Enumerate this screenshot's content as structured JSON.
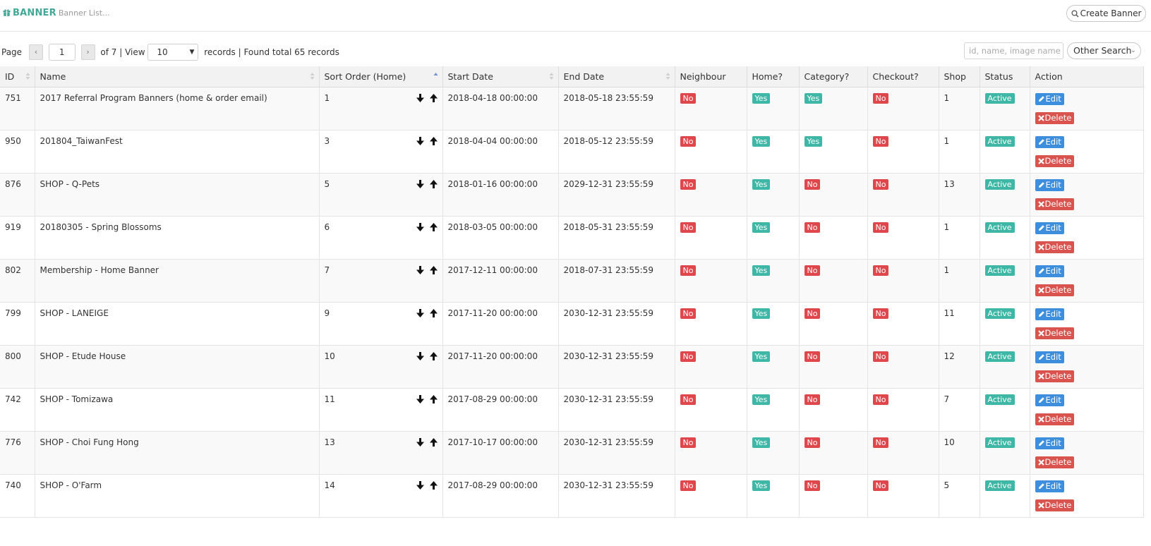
{
  "header": {
    "title": "BANNER",
    "subtitle": "Banner List...",
    "create_button": "Create Banner"
  },
  "pager": {
    "label_page": "Page",
    "prev_icon": "chevron-left-icon",
    "page_value": "1",
    "next_icon": "chevron-right-icon",
    "of_text": "of 7 | View",
    "per_page": "10",
    "records_text": "records | Found total 65 records"
  },
  "search": {
    "placeholder": "id, name, image name",
    "other_search": "Other Search"
  },
  "table": {
    "columns": [
      "ID",
      "Name",
      "Sort Order (Home)",
      "Start Date",
      "End Date",
      "Neighbour",
      "Home?",
      "Category?",
      "Checkout?",
      "Shop",
      "Status",
      "Action"
    ],
    "edit_label": "Edit",
    "delete_label": "Delete",
    "rows": [
      {
        "id": "751",
        "name": "2017 Referral Program Banners (home & order email)",
        "sort": "1",
        "start": "2018-04-18 00:00:00",
        "end": "2018-05-18 23:55:59",
        "neighbour": "No",
        "home": "Yes",
        "category": "Yes",
        "checkout": "No",
        "shop": "1",
        "status": "Active"
      },
      {
        "id": "950",
        "name": "201804_TaiwanFest",
        "sort": "3",
        "start": "2018-04-04 00:00:00",
        "end": "2018-05-12 23:55:59",
        "neighbour": "No",
        "home": "Yes",
        "category": "Yes",
        "checkout": "No",
        "shop": "1",
        "status": "Active"
      },
      {
        "id": "876",
        "name": "SHOP - Q-Pets",
        "sort": "5",
        "start": "2018-01-16 00:00:00",
        "end": "2029-12-31 23:55:59",
        "neighbour": "No",
        "home": "Yes",
        "category": "No",
        "checkout": "No",
        "shop": "13",
        "status": "Active"
      },
      {
        "id": "919",
        "name": "20180305 - Spring Blossoms",
        "sort": "6",
        "start": "2018-03-05 00:00:00",
        "end": "2018-05-31 23:55:59",
        "neighbour": "No",
        "home": "Yes",
        "category": "No",
        "checkout": "No",
        "shop": "1",
        "status": "Active"
      },
      {
        "id": "802",
        "name": "Membership - Home Banner",
        "sort": "7",
        "start": "2017-12-11 00:00:00",
        "end": "2018-07-31 23:55:59",
        "neighbour": "No",
        "home": "Yes",
        "category": "No",
        "checkout": "No",
        "shop": "1",
        "status": "Active"
      },
      {
        "id": "799",
        "name": "SHOP - LANEIGE",
        "sort": "9",
        "start": "2017-11-20 00:00:00",
        "end": "2030-12-31 23:55:59",
        "neighbour": "No",
        "home": "Yes",
        "category": "No",
        "checkout": "No",
        "shop": "11",
        "status": "Active"
      },
      {
        "id": "800",
        "name": "SHOP - Etude House",
        "sort": "10",
        "start": "2017-11-20 00:00:00",
        "end": "2030-12-31 23:55:59",
        "neighbour": "No",
        "home": "Yes",
        "category": "No",
        "checkout": "No",
        "shop": "12",
        "status": "Active"
      },
      {
        "id": "742",
        "name": "SHOP - Tomizawa",
        "sort": "11",
        "start": "2017-08-29 00:00:00",
        "end": "2030-12-31 23:55:59",
        "neighbour": "No",
        "home": "Yes",
        "category": "No",
        "checkout": "No",
        "shop": "7",
        "status": "Active"
      },
      {
        "id": "776",
        "name": "SHOP - Choi Fung Hong",
        "sort": "13",
        "start": "2017-10-17 00:00:00",
        "end": "2030-12-31 23:55:59",
        "neighbour": "No",
        "home": "Yes",
        "category": "No",
        "checkout": "No",
        "shop": "10",
        "status": "Active"
      },
      {
        "id": "740",
        "name": "SHOP - O'Farm",
        "sort": "14",
        "start": "2017-08-29 00:00:00",
        "end": "2030-12-31 23:55:59",
        "neighbour": "No",
        "home": "Yes",
        "category": "No",
        "checkout": "No",
        "shop": "5",
        "status": "Active"
      }
    ]
  },
  "colors": {
    "accent": "#42a898",
    "no_badge": "#e0474c",
    "yes_badge": "#3fb7a6",
    "edit_button": "#3d8edd",
    "delete_button": "#d9534f"
  }
}
